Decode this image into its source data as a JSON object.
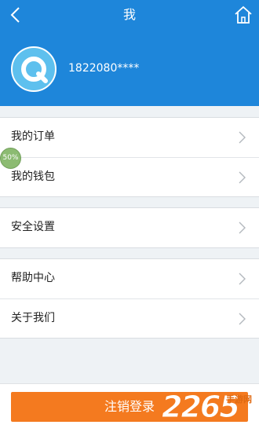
{
  "header": {
    "title": "我",
    "back_icon": "chevron-left-icon",
    "home_icon": "home-icon",
    "background": "#1e86da"
  },
  "profile": {
    "avatar_icon": "q-logo-icon",
    "username": "1822080****"
  },
  "menu_groups": [
    {
      "items": [
        {
          "label": "我的订单"
        },
        {
          "label": "我的钱包"
        }
      ]
    },
    {
      "items": [
        {
          "label": "安全设置"
        }
      ]
    },
    {
      "items": [
        {
          "label": "帮助中心"
        },
        {
          "label": "关于我们"
        }
      ]
    }
  ],
  "overlay_badge": {
    "text": "50%"
  },
  "logout": {
    "label": "注销登录",
    "color": "#f47a1f"
  },
  "watermark": {
    "number": "2265",
    "text": "手游网",
    "suffix": ".com"
  }
}
